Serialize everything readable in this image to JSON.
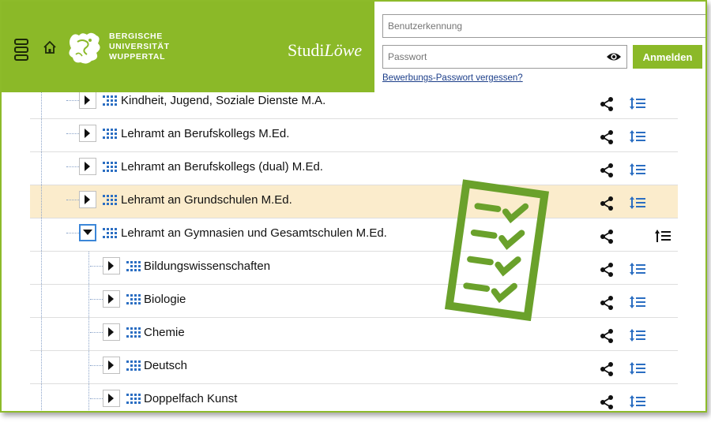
{
  "header": {
    "university": [
      "BERGISCHE",
      "UNIVERSITÄT",
      "WUPPERTAL"
    ],
    "app_name_plain": "Studi",
    "app_name_italic": "Löwe"
  },
  "login": {
    "username_placeholder": "Benutzerkennung",
    "password_placeholder": "Passwort",
    "submit_label": "Anmelden",
    "forgot_link": "Bewerbungs-Passwort vergessen?"
  },
  "tree": {
    "rows": [
      {
        "label": "Kindheit, Jugend, Soziale Dienste M.A.",
        "level": 1,
        "expanded": false,
        "highlighted": false
      },
      {
        "label": "Lehramt an Berufskollegs M.Ed.",
        "level": 1,
        "expanded": false,
        "highlighted": false
      },
      {
        "label": "Lehramt an Berufskollegs (dual) M.Ed.",
        "level": 1,
        "expanded": false,
        "highlighted": false
      },
      {
        "label": "Lehramt an Grundschulen M.Ed.",
        "level": 1,
        "expanded": false,
        "highlighted": true
      },
      {
        "label": "Lehramt an Gymnasien und Gesamtschulen M.Ed.",
        "level": 1,
        "expanded": true,
        "highlighted": false
      },
      {
        "label": "Bildungswissenschaften",
        "level": 2,
        "expanded": false,
        "highlighted": false
      },
      {
        "label": "Biologie",
        "level": 2,
        "expanded": false,
        "highlighted": false
      },
      {
        "label": "Chemie",
        "level": 2,
        "expanded": false,
        "highlighted": false
      },
      {
        "label": "Deutsch",
        "level": 2,
        "expanded": false,
        "highlighted": false
      },
      {
        "label": "Doppelfach Kunst",
        "level": 2,
        "expanded": false,
        "highlighted": false
      }
    ]
  },
  "colors": {
    "brand_green": "#8bb928",
    "highlight_row": "#fbeccc",
    "link_blue": "#1d3f8a",
    "icon_blue": "#2b6ec2",
    "checklist_green": "#6aa12b"
  }
}
